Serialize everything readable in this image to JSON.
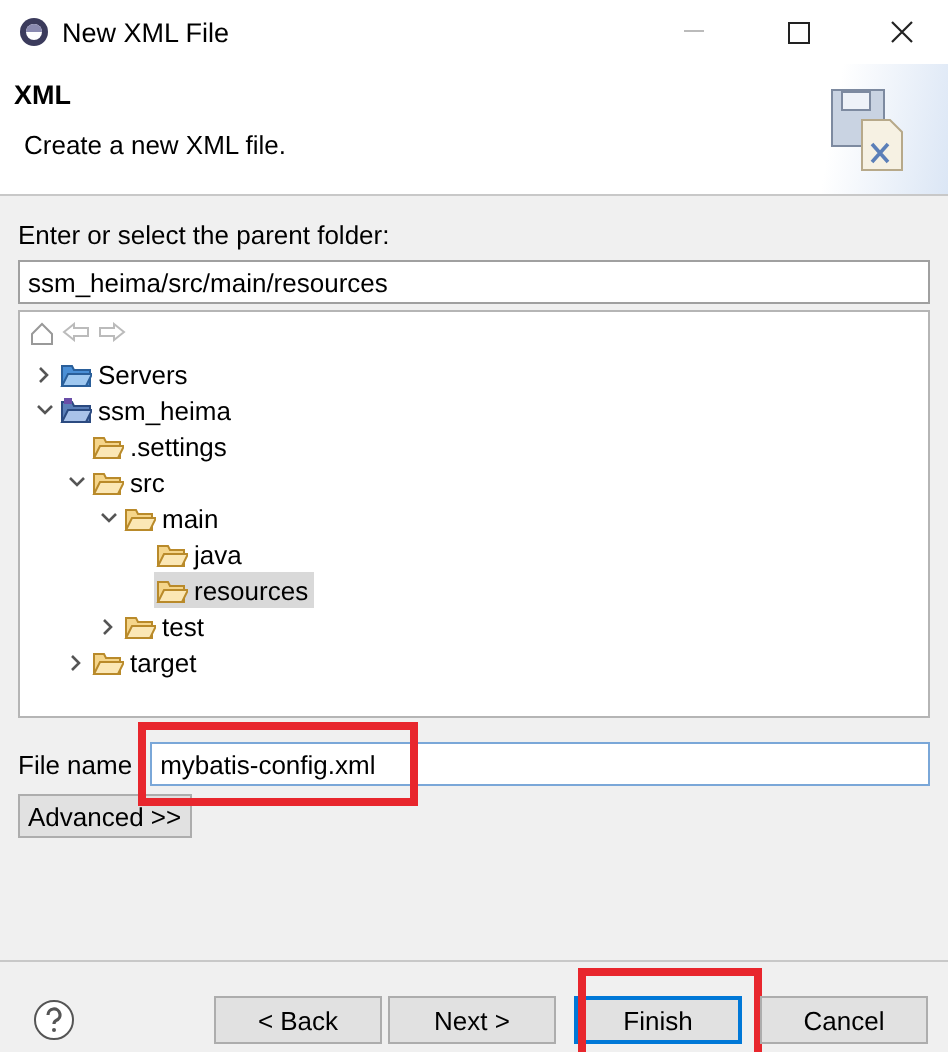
{
  "window": {
    "title": "New XML File"
  },
  "header": {
    "title": "XML",
    "description": "Create a new XML file."
  },
  "folder": {
    "label": "Enter or select the parent folder:",
    "value": "ssm_heima/src/main/resources"
  },
  "tree": [
    {
      "label": "Servers",
      "kind": "servers",
      "expanded": false,
      "selected": false
    },
    {
      "label": "ssm_heima",
      "kind": "project",
      "expanded": true,
      "selected": false,
      "children": [
        {
          "label": ".settings",
          "kind": "folder",
          "selected": false
        },
        {
          "label": "src",
          "kind": "folder",
          "expanded": true,
          "selected": false,
          "children": [
            {
              "label": "main",
              "kind": "folder",
              "expanded": true,
              "selected": false,
              "children": [
                {
                  "label": "java",
                  "kind": "folder",
                  "selected": false
                },
                {
                  "label": "resources",
                  "kind": "folder",
                  "selected": true
                }
              ]
            },
            {
              "label": "test",
              "kind": "folder",
              "expanded": false,
              "selected": false
            }
          ]
        },
        {
          "label": "target",
          "kind": "folder",
          "expanded": false,
          "selected": false
        }
      ]
    }
  ],
  "file_name": {
    "label": "File name",
    "value": "mybatis-config.xml",
    "highlighted": true
  },
  "advanced_button": "Advanced >>",
  "buttons": [
    {
      "label": "< Back",
      "default": false,
      "highlighted": false
    },
    {
      "label": "Next >",
      "default": false,
      "highlighted": false
    },
    {
      "label": "Finish",
      "default": true,
      "highlighted": true
    },
    {
      "label": "Cancel",
      "default": false,
      "highlighted": false
    }
  ]
}
